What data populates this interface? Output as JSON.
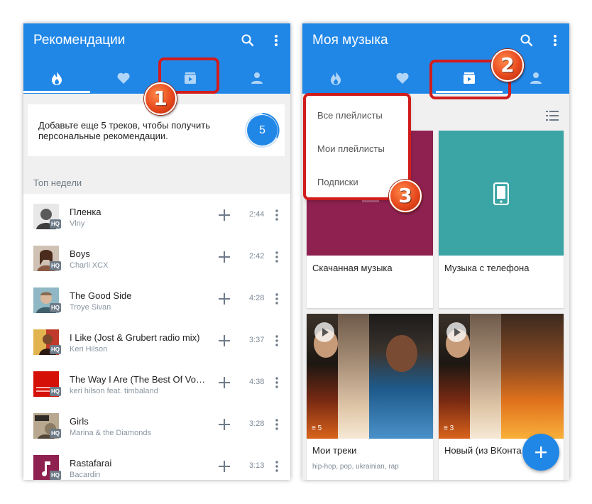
{
  "left": {
    "title": "Рекомендации",
    "promo_text": "Добавьте еще 5 треков, чтобы получить персональные рекомендации.",
    "promo_count": "5",
    "section_title": "Топ недели",
    "hq_label": "HQ",
    "tracks": [
      {
        "title": "Пленка",
        "artist": "Vlny",
        "duration": "2:44"
      },
      {
        "title": "Boys",
        "artist": "Charli XCX",
        "duration": "2:42"
      },
      {
        "title": "The Good Side",
        "artist": "Troye Sivan",
        "duration": "4:28"
      },
      {
        "title": "I Like (Jost & Grubert radio mix)",
        "artist": "Keri Hilson",
        "duration": "3:37"
      },
      {
        "title": "The Way I Are (The Best Of Voc…",
        "artist": "keri hilson feat. timbaland",
        "duration": "4:38"
      },
      {
        "title": "Girls",
        "artist": "Marina & the Diamonds",
        "duration": "3:28"
      },
      {
        "title": "Rastafarai",
        "artist": "Bacardin",
        "duration": "3:13"
      }
    ]
  },
  "right": {
    "title": "Моя музыка",
    "dropdown": [
      "Все плейлисты",
      "Мои плейлисты",
      "Подписки"
    ],
    "cards": [
      {
        "title": "Скачанная музыка",
        "subtitle": ""
      },
      {
        "title": "Музыка с телефона",
        "subtitle": ""
      },
      {
        "title": "Мои треки",
        "subtitle": "hip-hop, pop, ukrainian, rap",
        "count": "5"
      },
      {
        "title": "Новый (из ВКонта",
        "subtitle": "",
        "count": "3"
      }
    ]
  },
  "badges": [
    "1",
    "2",
    "3"
  ],
  "colors": {
    "accent": "#2187e7",
    "highlight": "#d11c1c",
    "badge": "#e8491e"
  },
  "icons": [
    "search-icon",
    "more-vert-icon",
    "fire-icon",
    "heart-icon",
    "playlist-icon",
    "person-icon",
    "add-icon",
    "list-view-icon",
    "phone-icon",
    "play-icon"
  ]
}
